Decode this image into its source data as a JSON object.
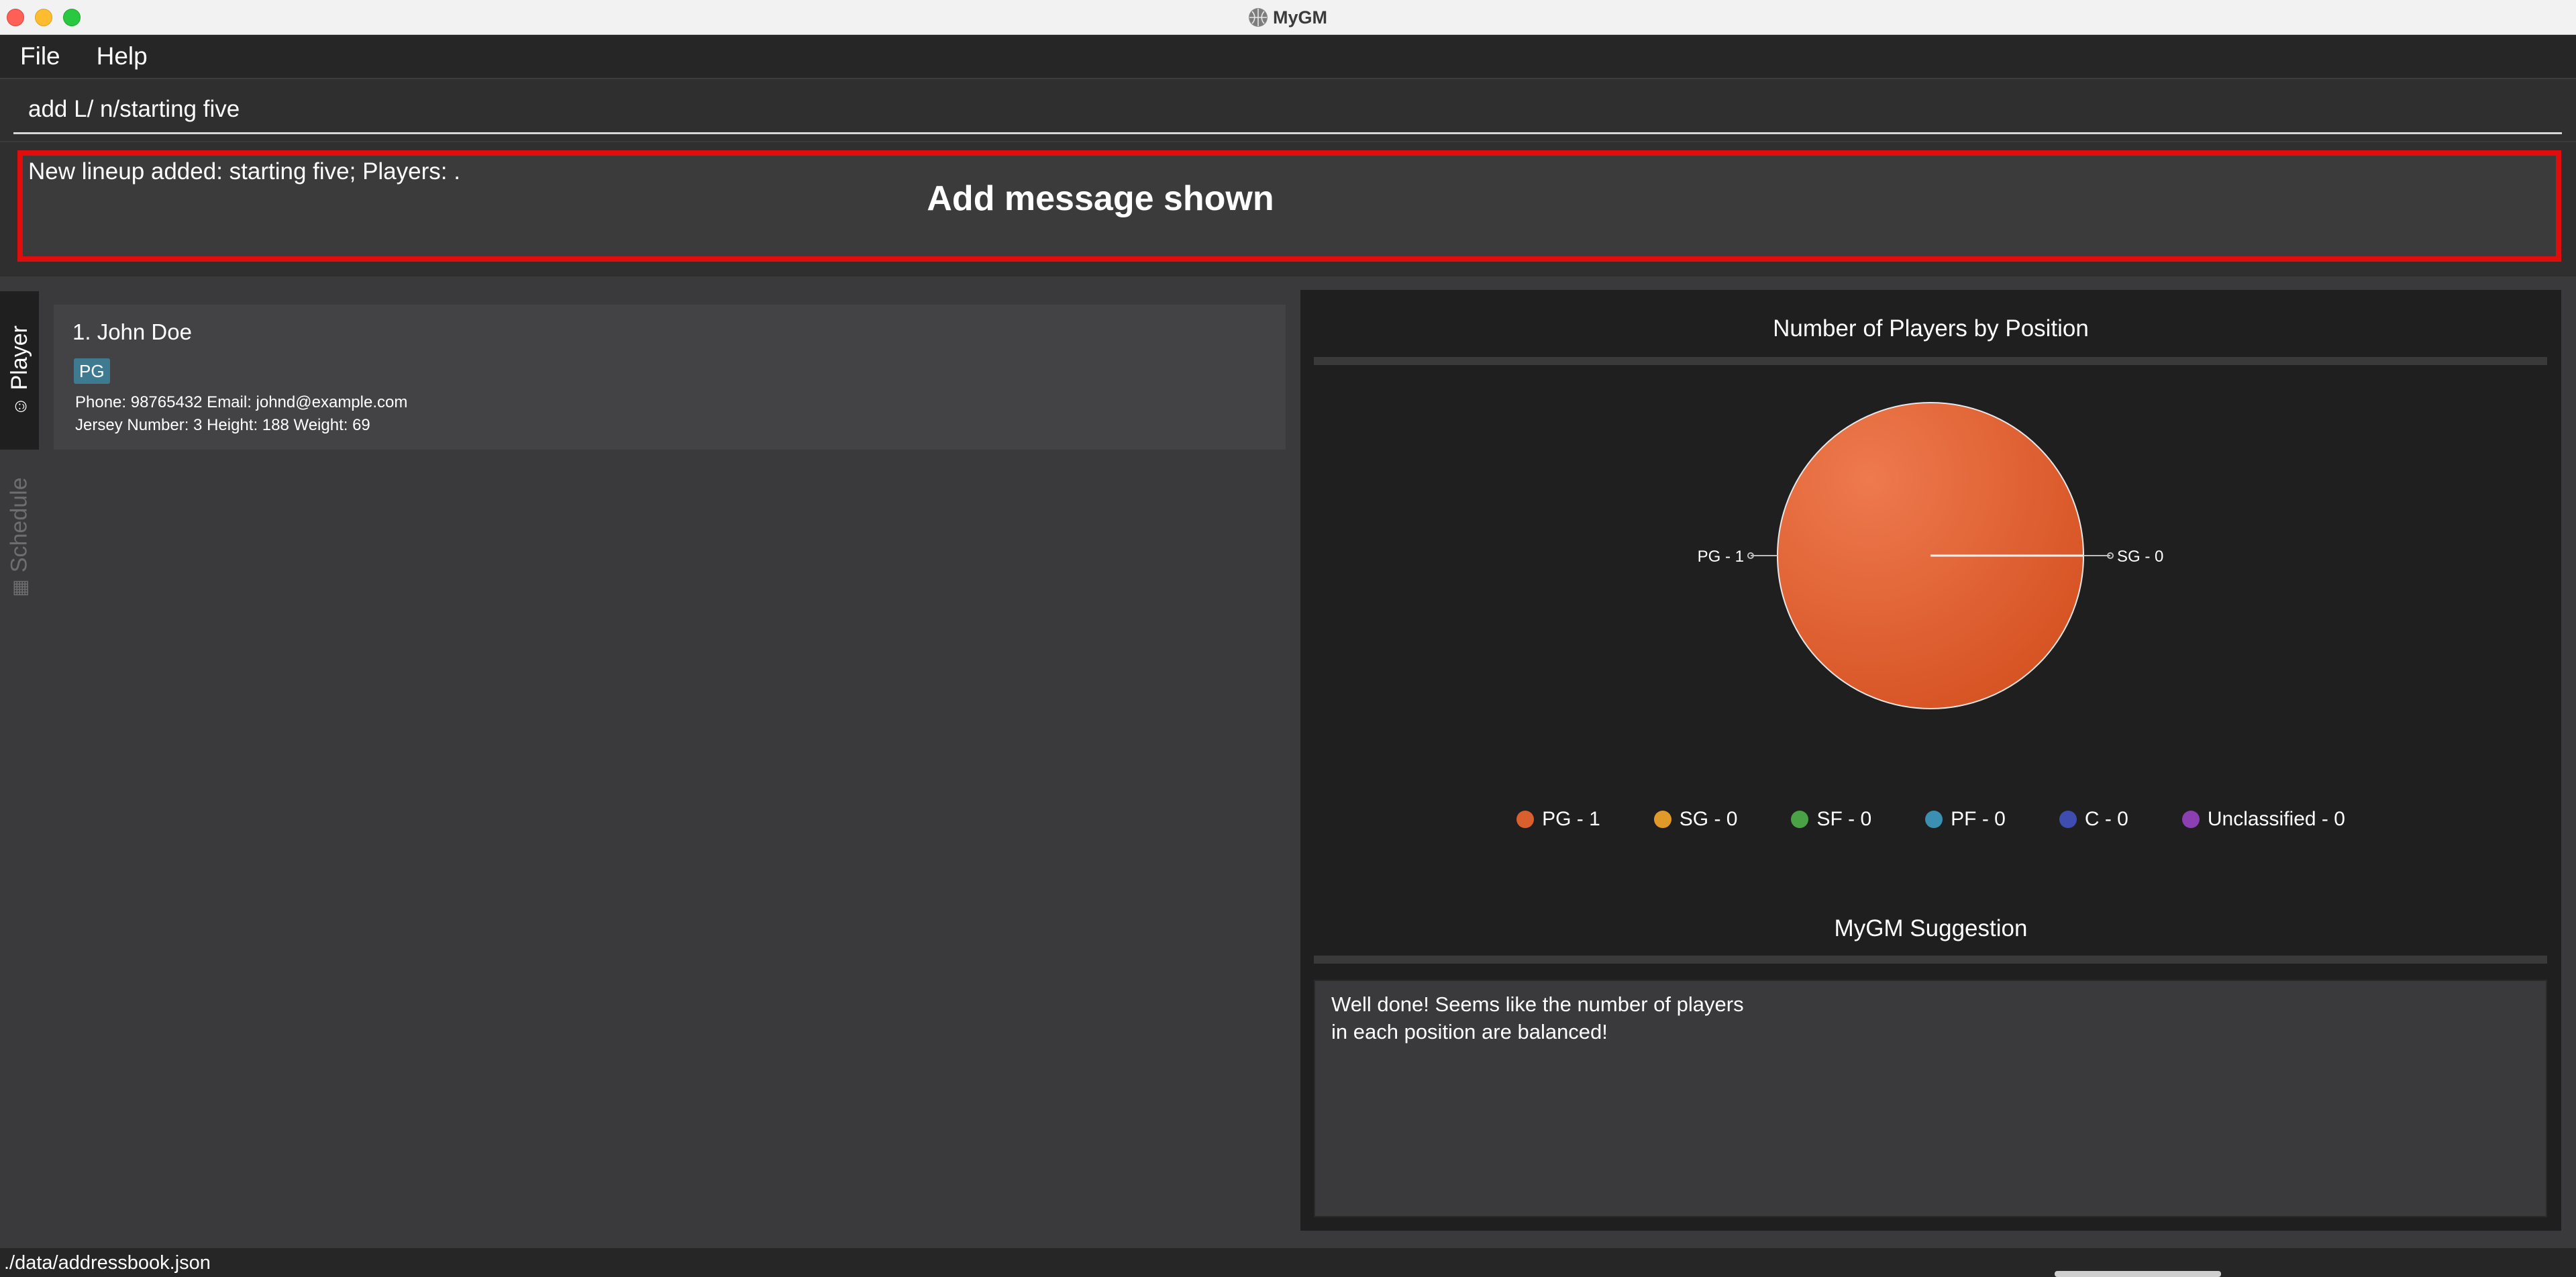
{
  "window": {
    "title": "MyGM"
  },
  "menu": {
    "items": [
      "File",
      "Help"
    ]
  },
  "command": {
    "value": "add L/ n/starting five"
  },
  "result": {
    "message": "New lineup added: starting five; Players: .",
    "annotation": "Add message shown",
    "highlight_color": "#e10d0d"
  },
  "tabs": {
    "player": {
      "label": "Player",
      "icon": "smiley-icon"
    },
    "schedule": {
      "label": "Schedule",
      "icon": "calendar-icon"
    }
  },
  "players": [
    {
      "index_name": "1.  John Doe",
      "tag": "PG",
      "line1": "Phone: 98765432   Email: johnd@example.com",
      "line2": "Jersey Number: 3   Height: 188   Weight: 69"
    }
  ],
  "chart_data": {
    "type": "pie",
    "title": "Number of Players by Position",
    "slices": [
      {
        "label": "PG",
        "value": 1,
        "color": "#d95f2e",
        "pie_label": "PG - 1"
      },
      {
        "label": "SG",
        "value": 0,
        "color": "#e09a2a",
        "pie_label": "SG - 0"
      }
    ],
    "legend": [
      {
        "label": "PG - 1",
        "color": "#d95f2e"
      },
      {
        "label": "SG - 0",
        "color": "#e09a2a"
      },
      {
        "label": "SF - 0",
        "color": "#4aa247"
      },
      {
        "label": "PF - 0",
        "color": "#3b8fb0"
      },
      {
        "label": "C - 0",
        "color": "#3f4db0"
      },
      {
        "label": "Unclassified - 0",
        "color": "#8c3fb0"
      }
    ]
  },
  "suggestion": {
    "title": "MyGM Suggestion",
    "text": "Well done! Seems like the number of players\nin each position are balanced!"
  },
  "status": {
    "path": "./data/addressbook.json"
  }
}
